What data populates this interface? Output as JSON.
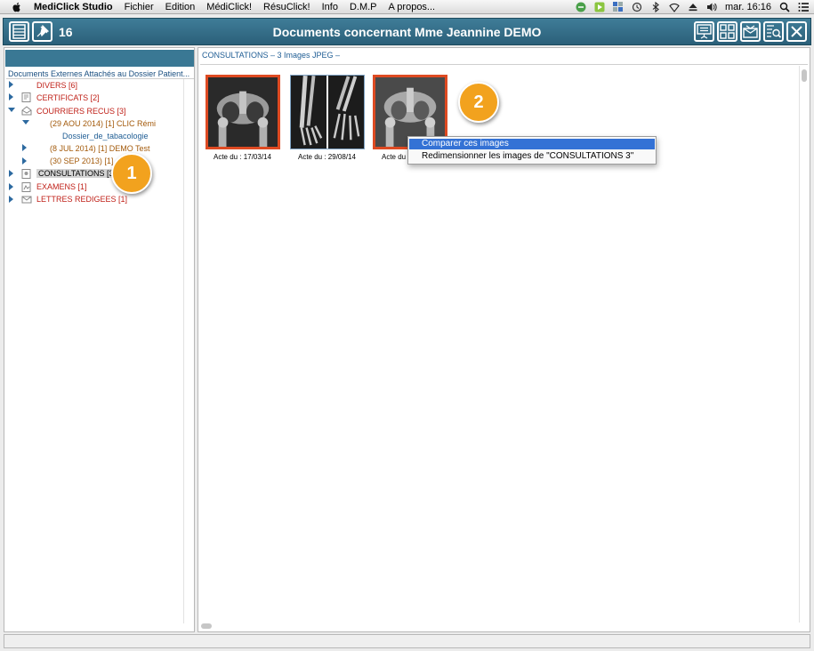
{
  "menubar": {
    "app_name": "MediClick Studio",
    "items": [
      "Fichier",
      "Edition",
      "MédiClick!",
      "RésuClick!",
      "Info",
      "D.M.P",
      "A propos..."
    ],
    "clock": "mar. 16:16"
  },
  "toolbar": {
    "count": "16",
    "title": "Documents concernant Mme Jeannine DEMO"
  },
  "left_panel": {
    "header": "Documents Externes Attachés au Dossier Patient...",
    "tree": [
      {
        "label": "DIVERS [6]",
        "color": "#c0221a"
      },
      {
        "label": "CERTIFICATS [2]",
        "color": "#c0221a"
      },
      {
        "label": "COURRIERS RECUS [3]",
        "color": "#c0221a"
      },
      {
        "label": "(29 AOU 2014) [1] CLIC Rémi",
        "color": "#a35a0b"
      },
      {
        "label": "Dossier_de_tabacologie",
        "color": "#1f5d94"
      },
      {
        "label": "(8 JUL 2014) [1] DEMO Test",
        "color": "#a35a0b"
      },
      {
        "label": "(30 SEP 2013) [1]",
        "color": "#a35a0b"
      },
      {
        "label": "CONSULTATIONS [3]",
        "color": "#000000"
      },
      {
        "label": "EXAMENS [1]",
        "color": "#c0221a"
      },
      {
        "label": "LETTRES REDIGEES [1]",
        "color": "#c0221a"
      }
    ]
  },
  "right_panel": {
    "breadcrumb": "CONSULTATIONS – 3 Images JPEG –",
    "images": [
      {
        "caption": "Acte du : 17/03/14"
      },
      {
        "caption": "Acte du : 29/08/14"
      },
      {
        "caption": "Acte du"
      }
    ]
  },
  "context_menu": {
    "items": [
      "Comparer ces images",
      "Redimensionner les images de \"CONSULTATIONS 3\""
    ]
  },
  "badges": [
    "1",
    "2"
  ],
  "colors": {
    "header_blue": "#2f6d88",
    "selection_orange": "#de4a22",
    "badge_orange": "#f2a21e",
    "menu_highlight": "#3472d5"
  }
}
